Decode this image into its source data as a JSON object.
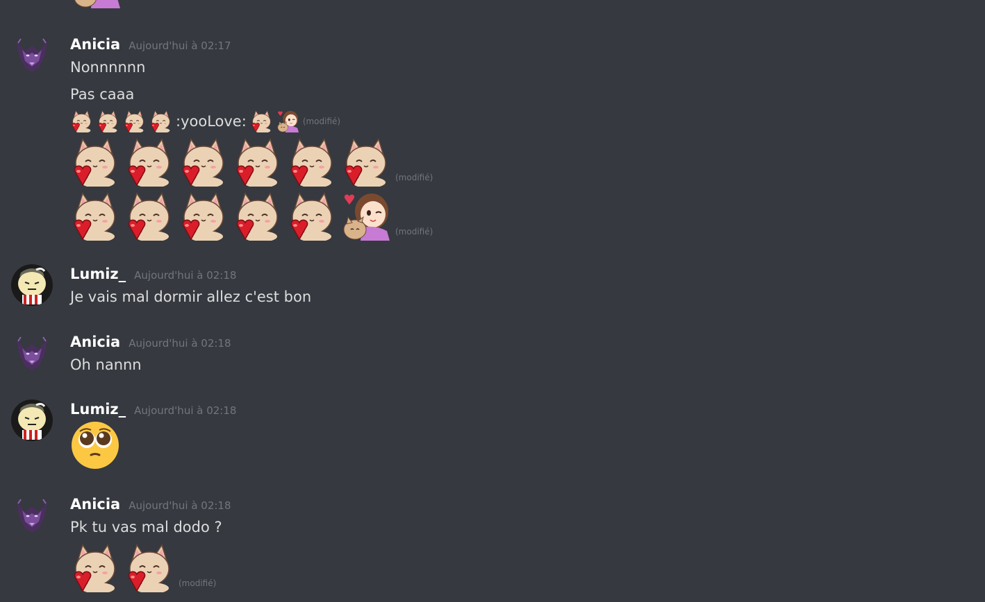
{
  "messages": [
    {
      "author": "Anicia",
      "time": "Aujourd'hui à 02:17",
      "lines": [
        "Nonnnnnn",
        "Pas caaa"
      ],
      "inline_text": ":yooLove:",
      "edited": "(modifié)"
    },
    {
      "author": "Lumiz_",
      "time": "Aujourd'hui à 02:18",
      "lines": [
        "Je vais mal dormir allez c'est bon"
      ]
    },
    {
      "author": "Anicia",
      "time": "Aujourd'hui à 02:18",
      "lines": [
        "Oh nannn"
      ]
    },
    {
      "author": "Lumiz_",
      "time": "Aujourd'hui à 02:18",
      "emoji": "pleading-face-emoji"
    },
    {
      "author": "Anicia",
      "time": "Aujourd'hui à 02:18",
      "lines": [
        "Pk tu vas mal dodo ?"
      ],
      "edited": "(modifié)"
    }
  ],
  "colors": {
    "background": "#36393f",
    "username": "#ffffff",
    "timestamp": "#72767d",
    "text": "#dcddde"
  },
  "icons": {
    "cat_heart": "cat-heart-emote",
    "girl_cat": "girl-cat-emote",
    "pleading": "pleading-face-emoji",
    "avatar_anicia": "wolf-avatar",
    "avatar_lumiz": "character-avatar"
  }
}
